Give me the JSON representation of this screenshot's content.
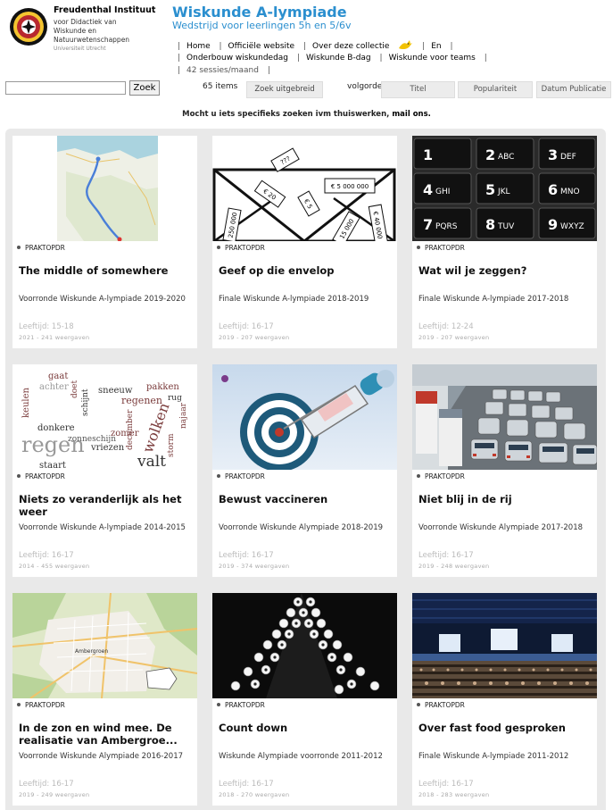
{
  "institute": {
    "name": "Freudenthal Instituut",
    "subtitle_lines": [
      "voor Didactiek van",
      "Wiskunde en",
      "Natuurwetenschappen"
    ],
    "university": "Universiteit Utrecht"
  },
  "site": {
    "title": "Wiskunde A-lympiade",
    "subtitle": "Wedstrijd voor leerlingen 5h en 5/6v"
  },
  "nav": {
    "row1": [
      "Home",
      "Officiële website",
      "Over deze collectie",
      "En"
    ],
    "row2": [
      "Onderbouw wiskundedag",
      "Wiskunde B-dag",
      "Wiskunde voor teams"
    ],
    "row3": [
      "42 sessies/maand"
    ]
  },
  "search": {
    "value": "",
    "button": "Zoek",
    "count": "65 items",
    "advanced": "Zoek uitgebreid",
    "sort_label": "volgorde",
    "sort_options": [
      "Titel",
      "Populariteit",
      "Datum Publicatie"
    ]
  },
  "info": {
    "text": "Mocht u iets specifieks zoeken ivm thuiswerken,",
    "link": "mail ons."
  },
  "colors": {
    "accent": "#2b8fcf",
    "grid_bg": "#e9e9e9",
    "muted": "#bbbbbb"
  },
  "cards": [
    {
      "tag": "PRAKTOPDR",
      "title": "The middle of somewhere",
      "round": "Voorronde Wiskunde A-lympiade 2019-2020",
      "age": "Leeftijd: 15-18",
      "meta": "2021 - 241 weergaven",
      "image": "map-route-image"
    },
    {
      "tag": "PRAKTOPDR",
      "title": "Geef op die envelop",
      "round": "Finale Wiskunde A-lympiade 2018-2019",
      "age": "Leeftijd: 16-17",
      "meta": "2019 - 207 weergaven",
      "image": "envelope-image",
      "image_labels": [
        "???",
        "€ 20",
        "€ 5 000 000",
        "€ 5",
        "250 000",
        "€ 40 000",
        "15 000"
      ]
    },
    {
      "tag": "PRAKTOPDR",
      "title": "Wat wil je zeggen?",
      "round": "Finale Wiskunde A-lympiade 2017-2018",
      "age": "Leeftijd: 12-24",
      "meta": "2019 - 207 weergaven",
      "image": "keypad-image",
      "image_labels": [
        "1",
        "2",
        "ABC",
        "3",
        "DEF",
        "4",
        "GHI",
        "5",
        "JKL",
        "6",
        "MNO",
        "7",
        "PQRS",
        "8",
        "TUV",
        "9",
        "WXYZ"
      ]
    },
    {
      "tag": "PRAKTOPDR",
      "title": "Niets zo veranderlijk als het weer",
      "round": "Voorronde Wiskunde A-lympiade 2014-2015",
      "age": "Leeftijd: 16-17",
      "meta": "2014 - 455 weergaven",
      "image": "word-cloud-image",
      "image_labels": [
        "gaat",
        "achter",
        "keulen",
        "doet",
        "sneeuw",
        "pakken",
        "regenen",
        "rug",
        "donkere",
        "regen",
        "zonneschijn",
        "wolken",
        "valt",
        "storm",
        "vriezen",
        "zomer",
        "december",
        "najaar",
        "staart",
        "schijnt"
      ]
    },
    {
      "tag": "PRAKTOPDR",
      "title": "Bewust vaccineren",
      "round": "Voorronde Wiskunde Alympiade 2018-2019",
      "age": "Leeftijd: 16-17",
      "meta": "2019 - 374 weergaven",
      "image": "vaccine-target-image"
    },
    {
      "tag": "PRAKTOPDR",
      "title": "Niet blij in de rij",
      "round": "Voorronde Wiskunde Alympiade 2017-2018",
      "age": "Leeftijd: 16-17",
      "meta": "2019 - 248 weergaven",
      "image": "traffic-jam-image"
    },
    {
      "tag": "PRAKTOPDR",
      "title": "In de zon en wind mee. De realisatie van Ambergroe...",
      "round": "Voorronde Wiskunde Alympiade 2016-2017",
      "age": "Leeftijd: 16-17",
      "meta": "2019 - 249 weergaven",
      "image": "town-map-image",
      "image_labels": [
        "Ambergroen"
      ]
    },
    {
      "tag": "PRAKTOPDR",
      "title": "Count down",
      "round": "Wiskunde Alympiade voorronde 2011-2012",
      "age": "Leeftijd: 16-17",
      "meta": "2018 - 270 weergaven",
      "image": "countdown-balls-image"
    },
    {
      "tag": "PRAKTOPDR",
      "title": "Over fast food gesproken",
      "round": "Finale Wiskunde A-lympiade 2011-2012",
      "age": "Leeftijd: 16-17",
      "meta": "2018 - 283 weergaven",
      "image": "conference-hall-image"
    }
  ]
}
